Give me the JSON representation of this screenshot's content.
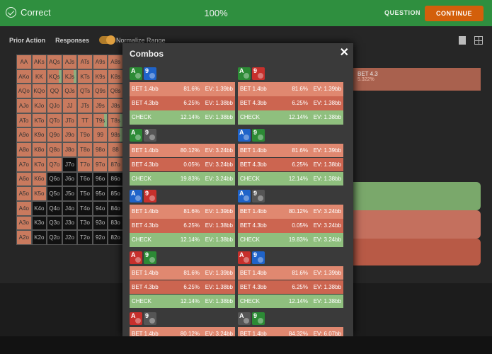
{
  "topbar": {
    "status": "Correct",
    "percent": "100%",
    "question": "QUESTION",
    "continue": "CONTINUE"
  },
  "tabs": {
    "prior_action": "Prior Action",
    "responses": "Responses",
    "normalize": "Normalize Range"
  },
  "grid": {
    "cells": [
      [
        "AA",
        "AKs",
        "AQs",
        "AJs",
        "ATs",
        "A9s",
        "A8s"
      ],
      [
        "AKo",
        "KK",
        "KQs",
        "KJs",
        "KTs",
        "K9s",
        "K8s"
      ],
      [
        "AQo",
        "KQo",
        "QQ",
        "QJs",
        "QTs",
        "Q9s",
        "Q8s"
      ],
      [
        "AJo",
        "KJo",
        "QJo",
        "JJ",
        "JTs",
        "J9s",
        "J8s"
      ],
      [
        "ATo",
        "KTo",
        "QTo",
        "JTo",
        "TT",
        "T9s",
        "T8s"
      ],
      [
        "A9o",
        "K9o",
        "Q9o",
        "J9o",
        "T9o",
        "99",
        "98s"
      ],
      [
        "A8o",
        "K8o",
        "Q8o",
        "J8o",
        "T8o",
        "98o",
        "88"
      ],
      [
        "A7o",
        "K7o",
        "Q7o",
        "J7o",
        "T7o",
        "97o",
        "87o"
      ],
      [
        "A6o",
        "K6o",
        "Q6o",
        "J6o",
        "T6o",
        "96o",
        "86o"
      ],
      [
        "A5o",
        "K5o",
        "Q5o",
        "J5o",
        "T5o",
        "95o",
        "85o"
      ],
      [
        "A4o",
        "K4o",
        "Q4o",
        "J4o",
        "T4o",
        "94o",
        "84o"
      ],
      [
        "A3o",
        "K3o",
        "Q3o",
        "J3o",
        "T3o",
        "93o",
        "83o"
      ],
      [
        "A2o",
        "K2o",
        "Q2o",
        "J2o",
        "T2o",
        "92o",
        "82o"
      ]
    ]
  },
  "right_panel": {
    "bet_label": "BET 4.3",
    "bet_pct": "5.322%"
  },
  "modal": {
    "title": "Combos",
    "close": "✕",
    "left": [
      {
        "cards": [
          {
            "r": "A",
            "c": "green"
          },
          {
            "r": "9",
            "c": "blue"
          }
        ],
        "rows": [
          [
            "BET 1.4bb",
            "81.6%",
            "EV: 1.39bb"
          ],
          [
            "BET 4.3bb",
            "6.25%",
            "EV: 1.38bb"
          ],
          [
            "CHECK",
            "12.14%",
            "EV: 1.38bb"
          ]
        ]
      },
      {
        "cards": [
          {
            "r": "A",
            "c": "green"
          },
          {
            "r": "9",
            "c": "grey"
          }
        ],
        "rows": [
          [
            "BET 1.4bb",
            "80.12%",
            "EV: 3.24bb"
          ],
          [
            "BET 4.3bb",
            "0.05%",
            "EV: 3.24bb"
          ],
          [
            "CHECK",
            "19.83%",
            "EV: 3.24bb"
          ]
        ]
      },
      {
        "cards": [
          {
            "r": "A",
            "c": "blue"
          },
          {
            "r": "9",
            "c": "red"
          }
        ],
        "rows": [
          [
            "BET 1.4bb",
            "81.6%",
            "EV: 1.39bb"
          ],
          [
            "BET 4.3bb",
            "6.25%",
            "EV: 1.38bb"
          ],
          [
            "CHECK",
            "12.14%",
            "EV: 1.38bb"
          ]
        ]
      },
      {
        "cards": [
          {
            "r": "A",
            "c": "red"
          },
          {
            "r": "9",
            "c": "green"
          }
        ],
        "rows": [
          [
            "BET 1.4bb",
            "81.6%",
            "EV: 1.39bb"
          ],
          [
            "BET 4.3bb",
            "6.25%",
            "EV: 1.38bb"
          ],
          [
            "CHECK",
            "12.14%",
            "EV: 1.38bb"
          ]
        ]
      },
      {
        "cards": [
          {
            "r": "A",
            "c": "red"
          },
          {
            "r": "9",
            "c": "grey"
          }
        ],
        "rows": [
          [
            "BET 1.4bb",
            "80.12%",
            "EV: 3.24bb"
          ]
        ]
      }
    ],
    "right": [
      {
        "cards": [
          {
            "r": "A",
            "c": "green"
          },
          {
            "r": "9",
            "c": "red"
          }
        ],
        "rows": [
          [
            "BET 1.4bb",
            "81.6%",
            "EV: 1.39bb"
          ],
          [
            "BET 4.3bb",
            "6.25%",
            "EV: 1.38bb"
          ],
          [
            "CHECK",
            "12.14%",
            "EV: 1.38bb"
          ]
        ]
      },
      {
        "cards": [
          {
            "r": "A",
            "c": "blue"
          },
          {
            "r": "9",
            "c": "green"
          }
        ],
        "rows": [
          [
            "BET 1.4bb",
            "81.6%",
            "EV: 1.39bb"
          ],
          [
            "BET 4.3bb",
            "6.25%",
            "EV: 1.38bb"
          ],
          [
            "CHECK",
            "12.14%",
            "EV: 1.38bb"
          ]
        ]
      },
      {
        "cards": [
          {
            "r": "A",
            "c": "blue"
          },
          {
            "r": "9",
            "c": "grey"
          }
        ],
        "rows": [
          [
            "BET 1.4bb",
            "80.12%",
            "EV: 3.24bb"
          ],
          [
            "BET 4.3bb",
            "0.05%",
            "EV: 3.24bb"
          ],
          [
            "CHECK",
            "19.83%",
            "EV: 3.24bb"
          ]
        ]
      },
      {
        "cards": [
          {
            "r": "A",
            "c": "red"
          },
          {
            "r": "9",
            "c": "blue"
          }
        ],
        "rows": [
          [
            "BET 1.4bb",
            "81.6%",
            "EV: 1.39bb"
          ],
          [
            "BET 4.3bb",
            "6.25%",
            "EV: 1.38bb"
          ],
          [
            "CHECK",
            "12.14%",
            "EV: 1.38bb"
          ]
        ]
      },
      {
        "cards": [
          {
            "r": "A",
            "c": "grey"
          },
          {
            "r": "9",
            "c": "green"
          }
        ],
        "rows": [
          [
            "BET 1.4bb",
            "84.32%",
            "EV: 6.07bb"
          ]
        ]
      }
    ]
  }
}
